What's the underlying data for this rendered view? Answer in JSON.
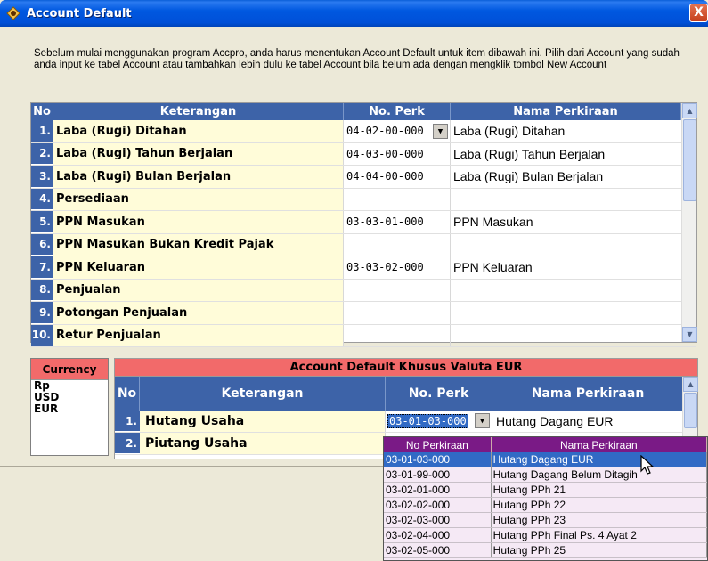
{
  "window": {
    "title": "Account Default",
    "close_label": "X"
  },
  "intro_text": "Sebelum mulai menggunakan program Accpro, anda harus menentukan  Account  Default untuk item dibawah ini. Pilih dari Account yang sudah anda input ke tabel Account atau tambahkan lebih dulu ke tabel Account bila belum ada dengan mengklik tombol New Account",
  "main_grid": {
    "headers": {
      "no": "No",
      "keterangan": "Keterangan",
      "no_perk": "No. Perk",
      "nama": "Nama Perkiraan"
    },
    "rows": [
      {
        "no": "1.",
        "keterangan": "Laba (Rugi) Ditahan",
        "no_perk": "04-02-00-000",
        "nama": "Laba (Rugi) Ditahan"
      },
      {
        "no": "2.",
        "keterangan": "Laba (Rugi) Tahun Berjalan",
        "no_perk": "04-03-00-000",
        "nama": "Laba (Rugi) Tahun Berjalan"
      },
      {
        "no": "3.",
        "keterangan": "Laba (Rugi) Bulan Berjalan",
        "no_perk": "04-04-00-000",
        "nama": "Laba (Rugi) Bulan Berjalan"
      },
      {
        "no": "4.",
        "keterangan": "Persediaan",
        "no_perk": "",
        "nama": ""
      },
      {
        "no": "5.",
        "keterangan": "PPN Masukan",
        "no_perk": "03-03-01-000",
        "nama": "PPN Masukan"
      },
      {
        "no": "6.",
        "keterangan": "PPN Masukan Bukan Kredit Pajak",
        "no_perk": "",
        "nama": ""
      },
      {
        "no": "7.",
        "keterangan": "PPN Keluaran",
        "no_perk": "03-03-02-000",
        "nama": "PPN Keluaran"
      },
      {
        "no": "8.",
        "keterangan": "Penjualan",
        "no_perk": "",
        "nama": ""
      },
      {
        "no": "9.",
        "keterangan": "Potongan Penjualan",
        "no_perk": "",
        "nama": ""
      },
      {
        "no": "10.",
        "keterangan": "Retur Penjualan",
        "no_perk": "",
        "nama": ""
      }
    ]
  },
  "currency": {
    "header": "Currency",
    "items": [
      "Rp",
      "USD",
      "EUR"
    ]
  },
  "valuta_grid": {
    "title": "Account Default Khusus Valuta EUR",
    "headers": {
      "no": "No",
      "keterangan": "Keterangan",
      "no_perk": "No. Perk",
      "nama": "Nama Perkiraan"
    },
    "rows": [
      {
        "no": "1.",
        "keterangan": "Hutang Usaha",
        "no_perk": "03-01-03-000",
        "nama": "Hutang Dagang EUR"
      },
      {
        "no": "2.",
        "keterangan": "Piutang Usaha",
        "no_perk": "",
        "nama": ""
      }
    ]
  },
  "dropdown": {
    "headers": {
      "c1": "No Perkiraan",
      "c2": "Nama Perkiraan"
    },
    "rows": [
      {
        "c1": "03-01-03-000",
        "c2": "Hutang Dagang EUR"
      },
      {
        "c1": "03-01-99-000",
        "c2": "Hutang Dagang Belum Ditagih"
      },
      {
        "c1": "03-02-01-000",
        "c2": "Hutang PPh 21"
      },
      {
        "c1": "03-02-02-000",
        "c2": "Hutang PPh 22"
      },
      {
        "c1": "03-02-03-000",
        "c2": "Hutang PPh 23"
      },
      {
        "c1": "03-02-04-000",
        "c2": "Hutang PPh Final  Ps. 4 Ayat 2"
      },
      {
        "c1": "03-02-05-000",
        "c2": "Hutang PPh 25"
      }
    ],
    "selected_index": 0
  },
  "colors": {
    "header_blue": "#3d63a8",
    "label_yellow": "#fffcd9",
    "currency_red": "#f26a6a",
    "dropdown_purple": "#7a1a86"
  }
}
